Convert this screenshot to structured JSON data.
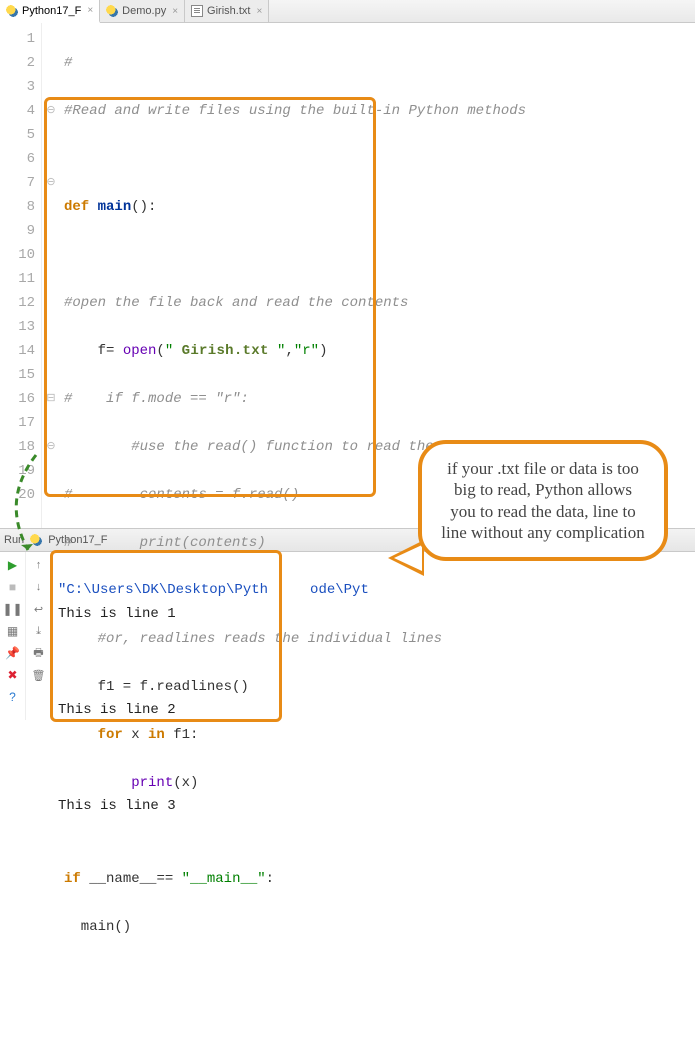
{
  "tabs": [
    {
      "label": "Python17_F",
      "active": true,
      "icon": "py"
    },
    {
      "label": "Demo.py",
      "active": false,
      "icon": "py"
    },
    {
      "label": "Girish.txt",
      "active": false,
      "icon": "txt"
    }
  ],
  "lineNumbers": [
    "1",
    "2",
    "3",
    "4",
    "5",
    "6",
    "7",
    "8",
    "9",
    "10",
    "11",
    "12",
    "13",
    "14",
    "15",
    "16",
    "17",
    "18",
    "19",
    "20"
  ],
  "code": {
    "l1": "#",
    "l2": "#Read and write files using the built-in Python methods",
    "l4_def": "def ",
    "l4_name": "main",
    "l4_rest": "():",
    "l6": "#open the file back and read the contents",
    "l7_pre": "    f= ",
    "l7_open": "open",
    "l7_p1": "(",
    "l7_s1": "\" ",
    "l7_fname": "Girish.txt",
    "l7_s1b": " \"",
    "l7_comma": ",",
    "l7_s2": "\"r\"",
    "l7_p2": ")",
    "l8": "#    if f.mode == \"r\":",
    "l9": "        #use the read() function to read the content",
    "l10": "#        contents = f.read()",
    "l11": "#        print(contents)",
    "l13": "    #or, readlines reads the individual lines",
    "l14": "    f1 = f.readlines()",
    "l15_for": "for ",
    "l15_x": "x ",
    "l15_in": "in ",
    "l15_rest": "f1:",
    "l16_pre": "        ",
    "l16_print": "print",
    "l16_rest": "(x)",
    "l18_if": "if ",
    "l18_name": "__name__",
    "l18_eq": "== ",
    "l18_main": "\"__main__\"",
    "l18_colon": ":",
    "l19": "  main()"
  },
  "bubble_text": "if your .txt file or data is too big to read, Python allows you to read the data, line to line without any complication",
  "run": {
    "title_prefix": "Run",
    "config": "Python17_F",
    "path": "\"C:\\Users\\DK\\Desktop\\Pyth     ode\\Pyt",
    "lines": [
      "This is line 1",
      "",
      "",
      "This is line 2",
      "",
      "",
      "This is line 3"
    ]
  },
  "icons": {
    "play": "▶",
    "stop": "■",
    "pause": "❚❚",
    "down": "↓",
    "up": "↑",
    "layout": "▦",
    "export": "⇲",
    "pin": "📌",
    "trash": "🗑",
    "x": "✖",
    "q": "?",
    "wrap": "↩",
    "scroll": "⤓",
    "print": "🖶",
    "filter": "⇅"
  }
}
